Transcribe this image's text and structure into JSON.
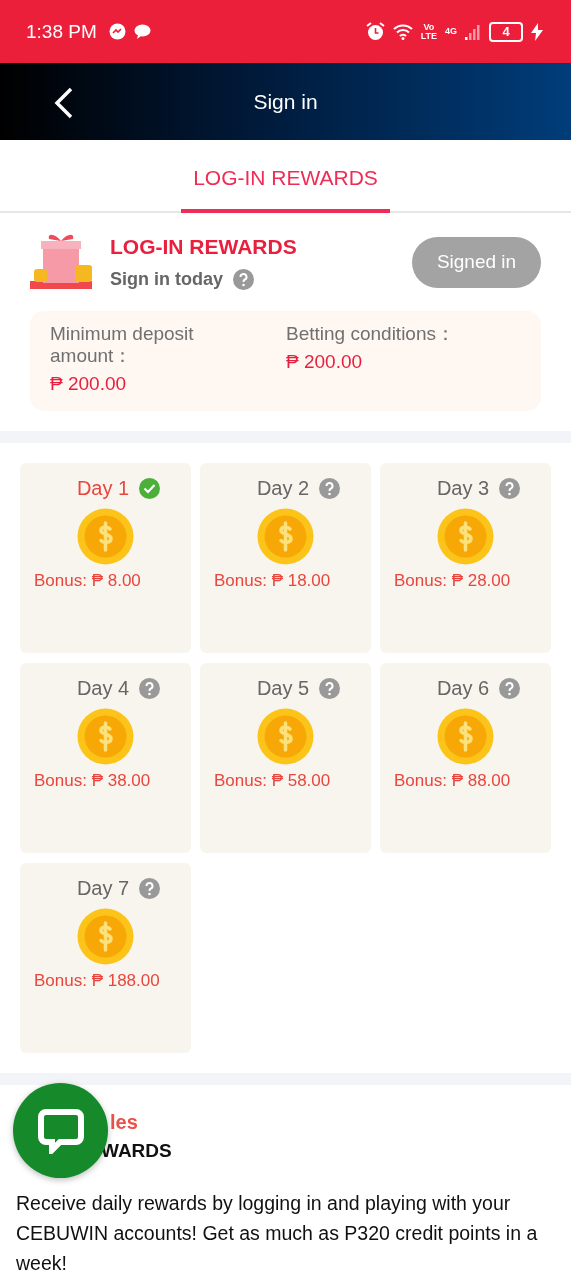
{
  "status_bar": {
    "time": "1:38 PM",
    "network_volte": "Vo\nLTE",
    "network_type": "4G",
    "battery": "4"
  },
  "header": {
    "title": "Sign in"
  },
  "tabs": [
    {
      "label": "LOG-IN REWARDS",
      "selected": true
    }
  ],
  "reward_card": {
    "title": "LOG-IN REWARDS",
    "subtitle": "Sign in today",
    "button": {
      "label": "Signed in",
      "disabled": true
    },
    "conditions": [
      {
        "label": "Minimum deposit amount：",
        "value": "₱ 200.00"
      },
      {
        "label": "Betting conditions：",
        "value": "₱ 200.00"
      }
    ]
  },
  "days": [
    {
      "label": "Day 1",
      "bonus": "Bonus: ₱ 8.00",
      "checked": true
    },
    {
      "label": "Day 2",
      "bonus": "Bonus: ₱ 18.00",
      "checked": false
    },
    {
      "label": "Day 3",
      "bonus": "Bonus: ₱ 28.00",
      "checked": false
    },
    {
      "label": "Day 4",
      "bonus": "Bonus: ₱ 38.00",
      "checked": false
    },
    {
      "label": "Day 5",
      "bonus": "Bonus: ₱ 58.00",
      "checked": false
    },
    {
      "label": "Day 6",
      "bonus": "Bonus: ₱ 88.00",
      "checked": false
    },
    {
      "label": "Day 7",
      "bonus": "Bonus: ₱ 188.00",
      "checked": false
    }
  ],
  "rules": {
    "heading_visible": "les",
    "subheading_visible": "WARDS",
    "body": "Receive daily rewards by logging in and playing with your CEBUWIN accounts! Get as much as P320 credit points in a week!"
  }
}
